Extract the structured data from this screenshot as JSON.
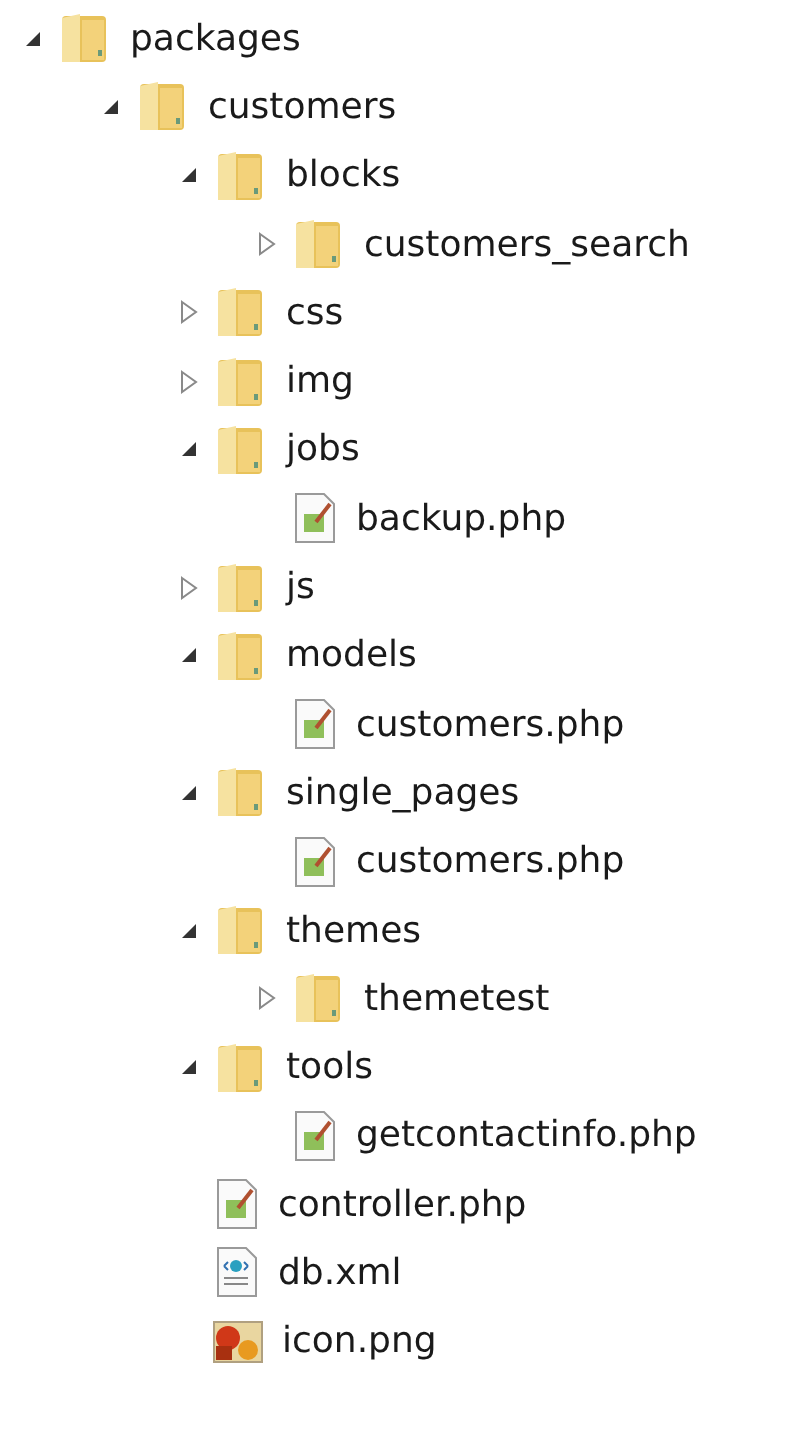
{
  "tree": [
    {
      "label": "packages",
      "kind": "folder",
      "expanded": true,
      "children": [
        {
          "label": "customers",
          "kind": "folder",
          "expanded": true,
          "children": [
            {
              "label": "blocks",
              "kind": "folder",
              "expanded": true,
              "children": [
                {
                  "label": "customers_search",
                  "kind": "folder",
                  "expanded": false
                }
              ]
            },
            {
              "label": "css",
              "kind": "folder",
              "expanded": false
            },
            {
              "label": "img",
              "kind": "folder",
              "expanded": false
            },
            {
              "label": "jobs",
              "kind": "folder",
              "expanded": true,
              "children": [
                {
                  "label": "backup.php",
                  "kind": "script"
                }
              ]
            },
            {
              "label": "js",
              "kind": "folder",
              "expanded": false
            },
            {
              "label": "models",
              "kind": "folder",
              "expanded": true,
              "children": [
                {
                  "label": "customers.php",
                  "kind": "script"
                }
              ]
            },
            {
              "label": "single_pages",
              "kind": "folder",
              "expanded": true,
              "children": [
                {
                  "label": "customers.php",
                  "kind": "script"
                }
              ]
            },
            {
              "label": "themes",
              "kind": "folder",
              "expanded": true,
              "children": [
                {
                  "label": "themetest",
                  "kind": "folder",
                  "expanded": false
                }
              ]
            },
            {
              "label": "tools",
              "kind": "folder",
              "expanded": true,
              "children": [
                {
                  "label": "getcontactinfo.php",
                  "kind": "script"
                }
              ]
            },
            {
              "label": "controller.php",
              "kind": "script"
            },
            {
              "label": "db.xml",
              "kind": "xml"
            },
            {
              "label": "icon.png",
              "kind": "image"
            }
          ]
        }
      ]
    }
  ]
}
